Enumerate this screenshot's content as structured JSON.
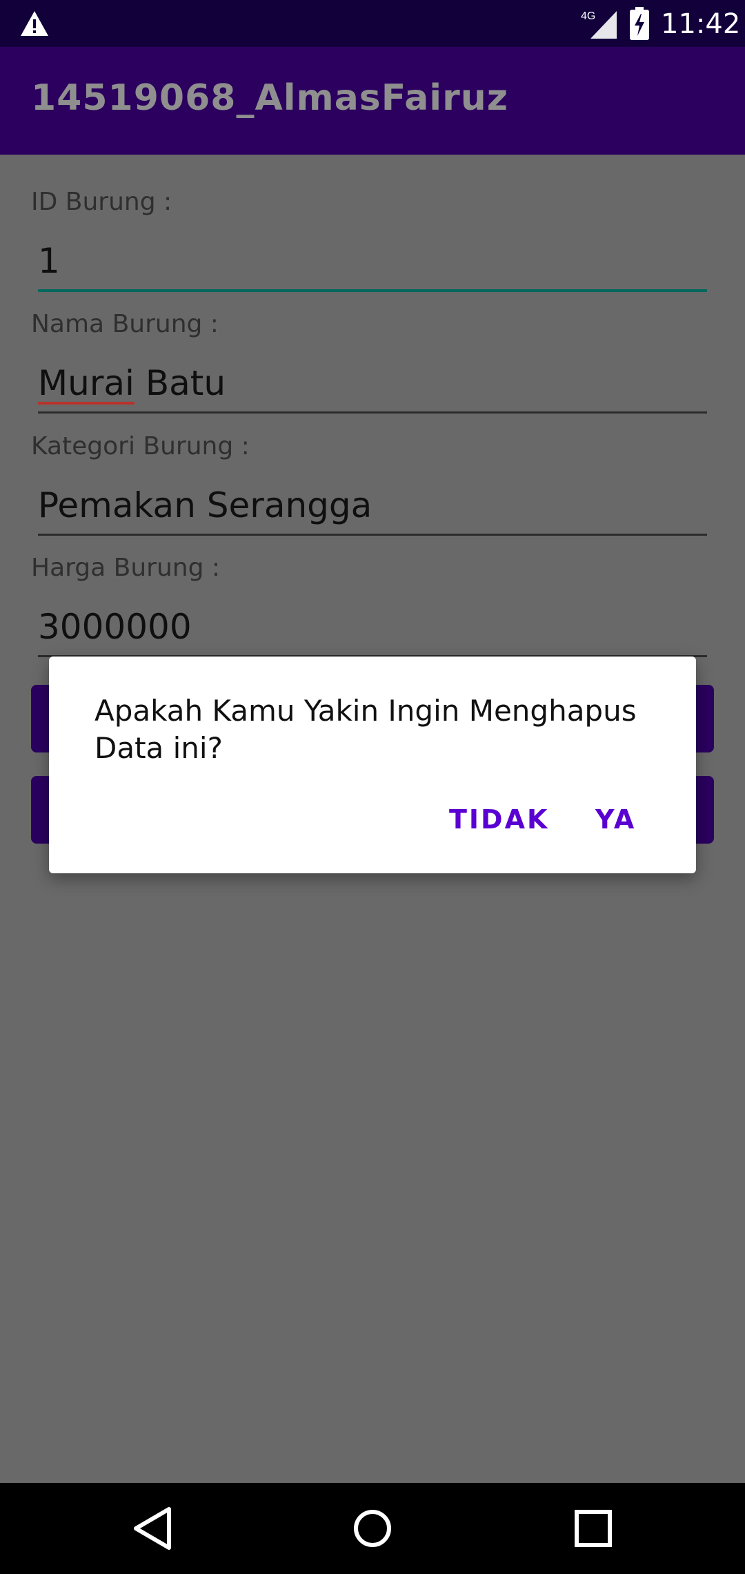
{
  "status_bar": {
    "network_label": "4G",
    "time": "11:42",
    "icons": [
      "warning-icon",
      "signal-icon",
      "battery-charging-icon"
    ]
  },
  "app_bar": {
    "title": "14519068_AlmasFairuz"
  },
  "form": {
    "fields": [
      {
        "label": "ID Burung :",
        "value": "1"
      },
      {
        "label": "Nama Burung :",
        "value_part1": "Murai",
        "value_part2": " Batu"
      },
      {
        "label": "Kategori Burung :",
        "value": "Pemakan Serangga"
      },
      {
        "label": "Harga Burung :",
        "value": "3000000"
      }
    ]
  },
  "dialog": {
    "message": "Apakah Kamu Yakin Ingin Menghapus Data ini?",
    "negative_button": "TIDAK",
    "positive_button": "YA"
  },
  "nav_bar": {
    "icons": [
      "back-icon",
      "home-icon",
      "recents-icon"
    ]
  },
  "colors": {
    "status_bar": "#12003b",
    "app_bar": "#2b005e",
    "accent": "#5a00d2",
    "focus_underline": "#03675e"
  }
}
